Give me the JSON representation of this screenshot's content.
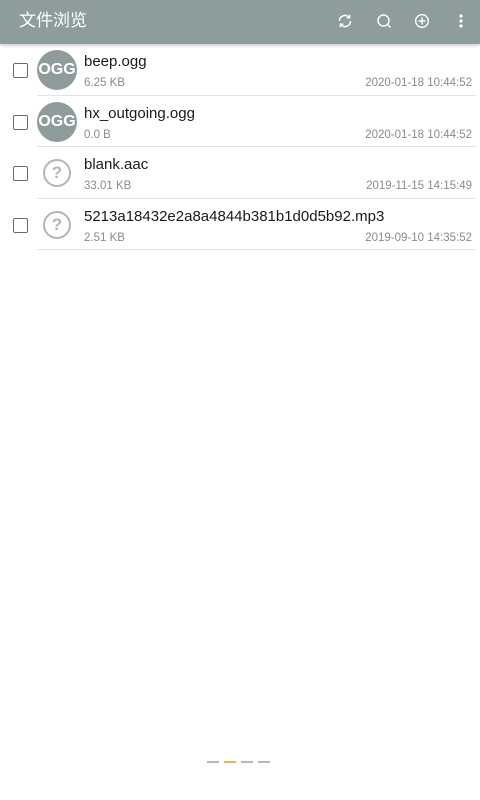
{
  "appbar": {
    "title": "文件浏览",
    "background": "#8e9d9c",
    "icons": [
      "refresh-icon",
      "search-icon",
      "add-icon",
      "more-vert-icon"
    ]
  },
  "files": [
    {
      "name": "beep.ogg",
      "size": "6.25 KB",
      "date": "2020-01-18 10:44:52",
      "thumb": "OGG"
    },
    {
      "name": "hx_outgoing.ogg",
      "size": "0.0 B",
      "date": "2020-01-18 10:44:52",
      "thumb": "OGG"
    },
    {
      "name": "blank.aac",
      "size": "33.01 KB",
      "date": "2019-11-15 14:15:49",
      "thumb": "?"
    },
    {
      "name": "5213a18432e2a8a4844b381b1d0d5b92.mp3",
      "size": "2.51 KB",
      "date": "2019-09-10 14:35:52",
      "thumb": "?"
    }
  ],
  "pager": {
    "pages": 4,
    "active_index": 1,
    "active_color": "#f0b34a"
  }
}
